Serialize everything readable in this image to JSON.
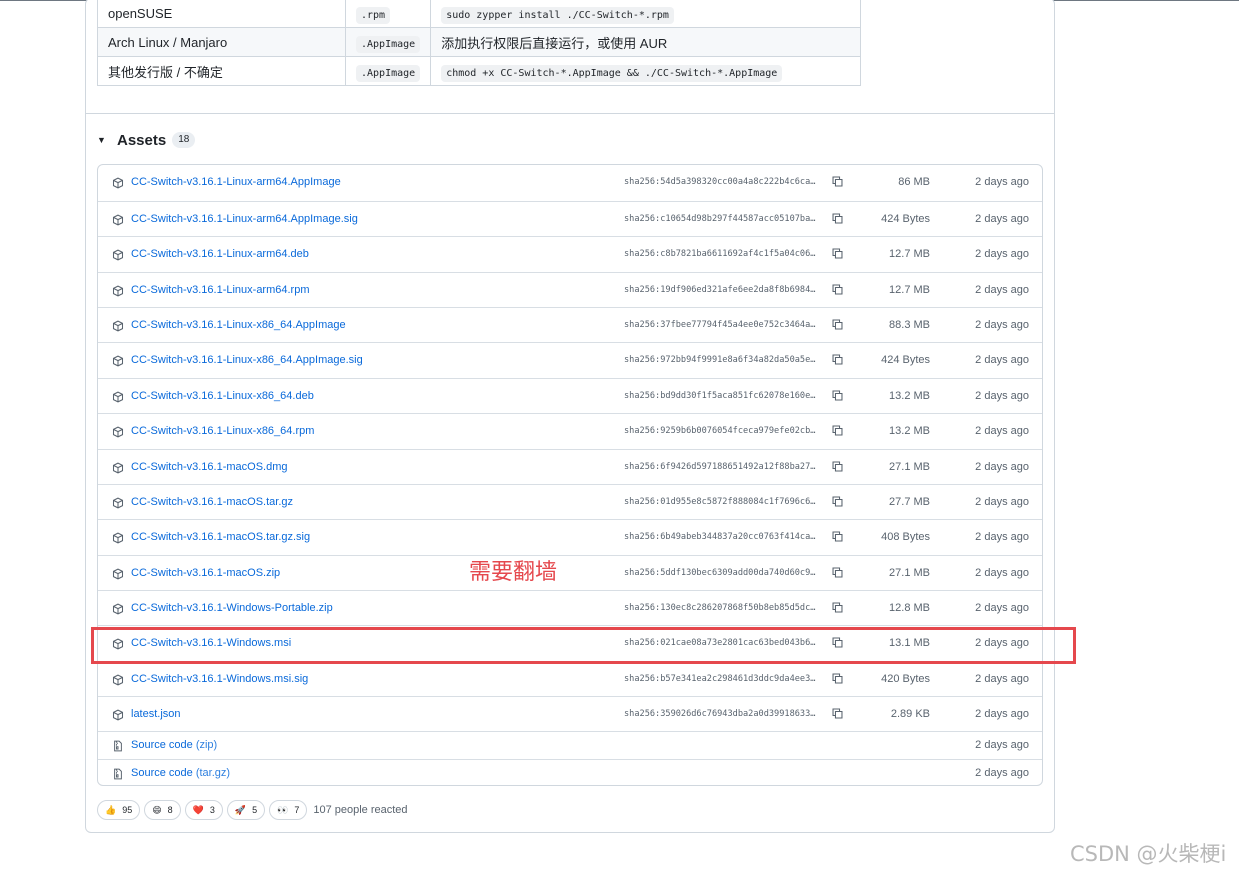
{
  "install_table": [
    {
      "distro": "openSUSE",
      "format": ".rpm",
      "command": "sudo zypper install ./CC-Switch-*.rpm",
      "command_is_code": true
    },
    {
      "distro": "Arch Linux / Manjaro",
      "format": ".AppImage",
      "command": "添加执行权限后直接运行，或使用 AUR",
      "command_is_code": false
    },
    {
      "distro": "其他发行版 / 不确定",
      "format": ".AppImage",
      "command": "chmod +x CC-Switch-*.AppImage && ./CC-Switch-*.AppImage",
      "command_is_code": true
    }
  ],
  "assets": {
    "title": "Assets",
    "count": "18",
    "items": [
      {
        "name": "CC-Switch-v3.16.1-Linux-arm64.AppImage",
        "sha": "sha256:54d5a398320cc00a4a8c222b4c6ca…",
        "size": "86 MB",
        "date": "2 days ago"
      },
      {
        "name": "CC-Switch-v3.16.1-Linux-arm64.AppImage.sig",
        "sha": "sha256:c10654d98b297f44587acc05107ba…",
        "size": "424 Bytes",
        "date": "2 days ago"
      },
      {
        "name": "CC-Switch-v3.16.1-Linux-arm64.deb",
        "sha": "sha256:c8b7821ba6611692af4c1f5a04c06…",
        "size": "12.7 MB",
        "date": "2 days ago"
      },
      {
        "name": "CC-Switch-v3.16.1-Linux-arm64.rpm",
        "sha": "sha256:19df906ed321afe6ee2da8f8b6984…",
        "size": "12.7 MB",
        "date": "2 days ago"
      },
      {
        "name": "CC-Switch-v3.16.1-Linux-x86_64.AppImage",
        "sha": "sha256:37fbee77794f45a4ee0e752c3464a…",
        "size": "88.3 MB",
        "date": "2 days ago"
      },
      {
        "name": "CC-Switch-v3.16.1-Linux-x86_64.AppImage.sig",
        "sha": "sha256:972bb94f9991e8a6f34a82da50a5e…",
        "size": "424 Bytes",
        "date": "2 days ago"
      },
      {
        "name": "CC-Switch-v3.16.1-Linux-x86_64.deb",
        "sha": "sha256:bd9dd30f1f5aca851fc62078e160e…",
        "size": "13.2 MB",
        "date": "2 days ago"
      },
      {
        "name": "CC-Switch-v3.16.1-Linux-x86_64.rpm",
        "sha": "sha256:9259b6b0076054fceca979efe02cb…",
        "size": "13.2 MB",
        "date": "2 days ago"
      },
      {
        "name": "CC-Switch-v3.16.1-macOS.dmg",
        "sha": "sha256:6f9426d597188651492a12f88ba27…",
        "size": "27.1 MB",
        "date": "2 days ago"
      },
      {
        "name": "CC-Switch-v3.16.1-macOS.tar.gz",
        "sha": "sha256:01d955e8c5872f888084c1f7696c6…",
        "size": "27.7 MB",
        "date": "2 days ago"
      },
      {
        "name": "CC-Switch-v3.16.1-macOS.tar.gz.sig",
        "sha": "sha256:6b49abeb344837a20cc0763f414ca…",
        "size": "408 Bytes",
        "date": "2 days ago"
      },
      {
        "name": "CC-Switch-v3.16.1-macOS.zip",
        "sha": "sha256:5ddf130bec6309add00da740d60c9…",
        "size": "27.1 MB",
        "date": "2 days ago"
      },
      {
        "name": "CC-Switch-v3.16.1-Windows-Portable.zip",
        "sha": "sha256:130ec8c286207868f50b8eb85d5dc…",
        "size": "12.8 MB",
        "date": "2 days ago"
      },
      {
        "name": "CC-Switch-v3.16.1-Windows.msi",
        "sha": "sha256:021cae08a73e2801cac63bed043b6…",
        "size": "13.1 MB",
        "date": "2 days ago"
      },
      {
        "name": "CC-Switch-v3.16.1-Windows.msi.sig",
        "sha": "sha256:b57e341ea2c298461d3ddc9da4ee3…",
        "size": "420 Bytes",
        "date": "2 days ago"
      },
      {
        "name": "latest.json",
        "sha": "sha256:359026d6c76943dba2a0d39918633…",
        "size": "2.89 KB",
        "date": "2 days ago"
      }
    ],
    "source_items": [
      {
        "label": "Source code",
        "ext": "(zip)",
        "date": "2 days ago"
      },
      {
        "label": "Source code",
        "ext": "(tar.gz)",
        "date": "2 days ago"
      }
    ]
  },
  "annotation": {
    "note": "需要翻墙",
    "highlight_color": "#e5484d"
  },
  "reactions": {
    "items": [
      {
        "emoji": "👍",
        "icon": "thumbs-up-icon",
        "count": "95"
      },
      {
        "emoji": "😄",
        "icon": "laugh-icon",
        "count": "8"
      },
      {
        "emoji": "❤️",
        "icon": "heart-icon",
        "count": "3"
      },
      {
        "emoji": "🚀",
        "icon": "rocket-icon",
        "count": "5"
      },
      {
        "emoji": "👀",
        "icon": "eyes-icon",
        "count": "7"
      }
    ],
    "summary": "107 people reacted"
  },
  "watermark": "CSDN @火柴梗i",
  "colors": {
    "link": "#0969da",
    "muted": "#59636e",
    "border": "#d0d7de"
  }
}
